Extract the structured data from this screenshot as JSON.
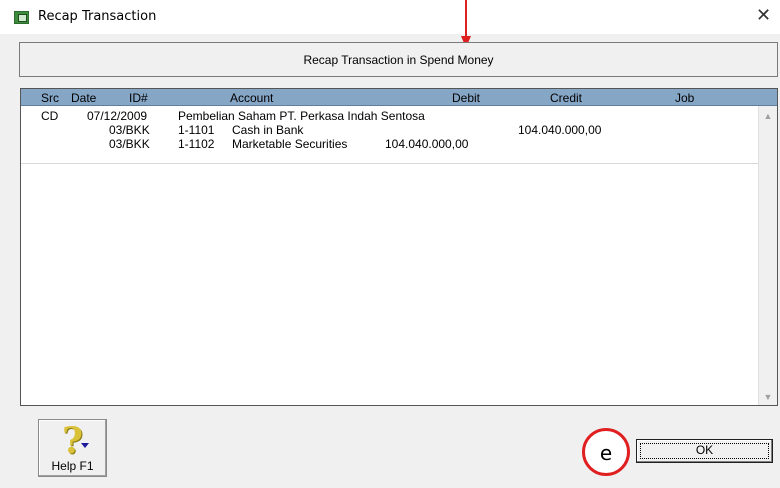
{
  "window": {
    "title": "Recap Transaction",
    "close_glyph": "✕"
  },
  "header": {
    "text": "Recap Transaction in Spend Money"
  },
  "table": {
    "columns": {
      "src": "Src",
      "date": "Date",
      "id": "ID#",
      "account": "Account",
      "debit": "Debit",
      "credit": "Credit",
      "job": "Job"
    },
    "rows": [
      {
        "src": "CD",
        "date": "07/12/2009",
        "id": "",
        "account_no": "",
        "account_name": "Pembelian Saham PT. Perkasa Indah Sentosa",
        "debit": "",
        "credit": ""
      },
      {
        "src": "",
        "date": "",
        "id": "03/BKK",
        "account_no": "1-1101",
        "account_name": "Cash in Bank",
        "debit": "",
        "credit": "104.040.000,00"
      },
      {
        "src": "",
        "date": "",
        "id": "03/BKK",
        "account_no": "1-1102",
        "account_name": "Marketable Securities",
        "debit": "104.040.000,00",
        "credit": ""
      }
    ]
  },
  "buttons": {
    "help": "Help F1",
    "ok": "OK"
  },
  "annotation": {
    "circle_label": "e",
    "colors": {
      "annotation": "#e02020"
    }
  },
  "icons": [
    "app-icon",
    "close-icon",
    "help-icon",
    "scroll-up-icon",
    "scroll-down-icon"
  ]
}
